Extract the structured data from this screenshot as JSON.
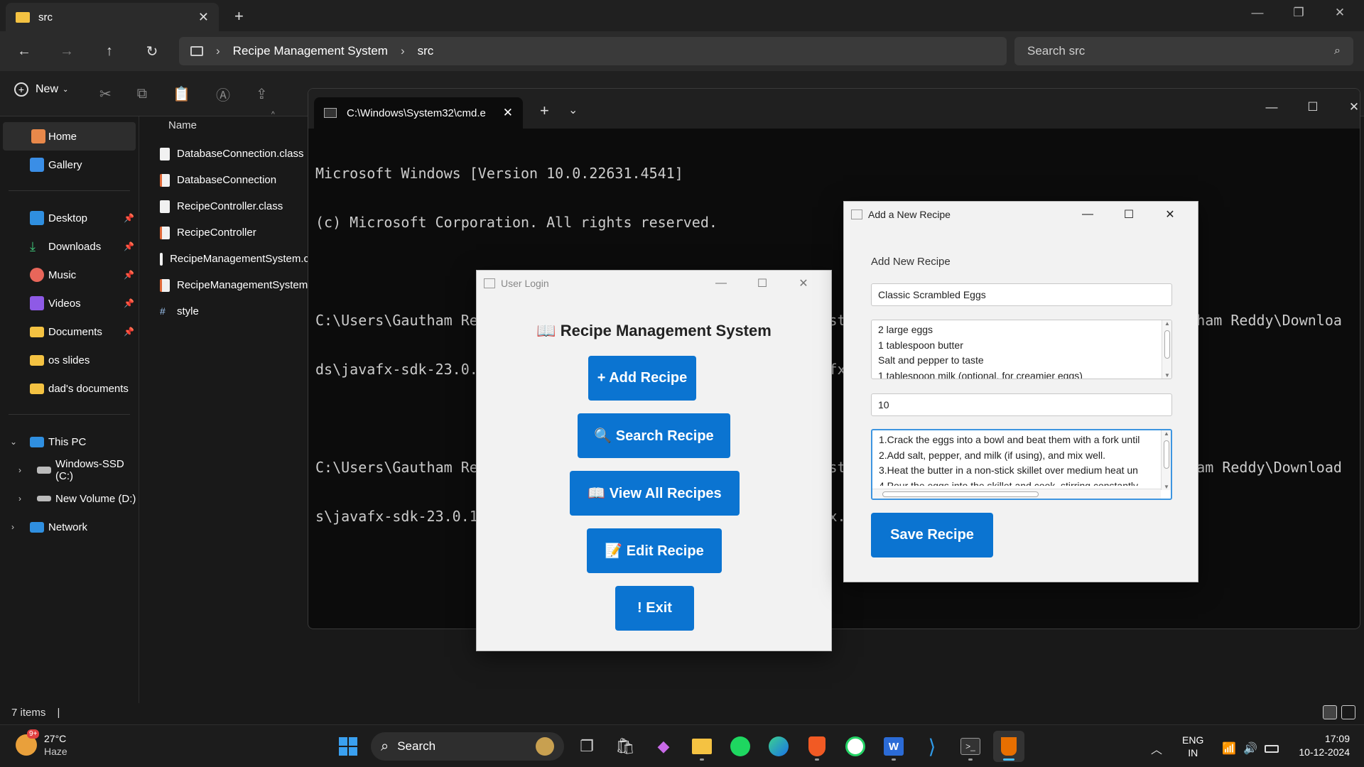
{
  "explorer": {
    "tab_title": "src",
    "breadcrumb": [
      "Recipe Management System",
      "src"
    ],
    "search_placeholder": "Search src",
    "new_label": "New",
    "column_name": "Name",
    "nav": {
      "home": "Home",
      "gallery": "Gallery",
      "pinned": [
        "Desktop",
        "Downloads",
        "Music",
        "Videos",
        "Documents"
      ],
      "folders": [
        "os slides",
        "dad's documents"
      ],
      "this_pc": "This PC",
      "drives": [
        "Windows-SSD (C:)",
        "New Volume (D:)"
      ],
      "network": "Network"
    },
    "files": [
      {
        "name": "DatabaseConnection.class",
        "type": "class"
      },
      {
        "name": "DatabaseConnection",
        "type": "java"
      },
      {
        "name": "RecipeController.class",
        "type": "class"
      },
      {
        "name": "RecipeController",
        "type": "java"
      },
      {
        "name": "RecipeManagementSystem.c",
        "type": "class"
      },
      {
        "name": "RecipeManagementSystem",
        "type": "java"
      },
      {
        "name": "style",
        "type": "css"
      }
    ],
    "status": "7 items"
  },
  "cmd": {
    "tab_title": "C:\\Windows\\System32\\cmd.e",
    "lines": [
      "Microsoft Windows [Version 10.0.22631.4541]",
      "(c) Microsoft Corporation. All rights reserved.",
      "",
      "C:\\Users\\Gautham Reddy\\OneDrive\\Desktop\\Recipe Management System\\src>javac --module-path \"C:\\Users\\Gautham Reddy\\Downloa",
      "ds\\javafx-sdk-23.0.1\\lib\" --add-modules javafx.controls,javafx.fxml *.java",
      "",
      "C:\\Users\\Gautham Reddy\\OneDrive\\Desktop\\Recipe Management System\\src>java --module-path \"C:\\Users\\Gautham Reddy\\Download",
      "s\\javafx-sdk-23.0.1\\lib\" --add-modules javafx.controls,javafx.fxml RecipeManagementSystem"
    ]
  },
  "login": {
    "title": "User Login",
    "heading": "📖 Recipe Management System",
    "buttons": {
      "add": "+ Add Recipe",
      "search": "🔍 Search Recipe",
      "view": "📖 View All Recipes",
      "edit": "📝 Edit Recipe",
      "exit": "! Exit"
    }
  },
  "add_recipe": {
    "title": "Add a New Recipe",
    "label": "Add New Recipe",
    "name_value": "Classic Scrambled Eggs",
    "ingredients": [
      "2 large eggs",
      "1 tablespoon butter",
      "Salt and pepper to taste",
      "1 tablespoon milk (optional, for creamier eggs)"
    ],
    "time_value": "10",
    "instructions": [
      "1.Crack the eggs into a bowl and beat them with a fork until",
      "2.Add salt, pepper, and milk (if using), and mix well.",
      "3.Heat the butter in a non-stick skillet over medium heat un",
      "4.Pour the eggs into the skillet and cook, stirring constantly"
    ],
    "save_label": "Save Recipe"
  },
  "taskbar": {
    "weather_temp": "27°C",
    "weather_desc": "Haze",
    "weather_badge": "9+",
    "search_label": "Search",
    "lang_top": "ENG",
    "lang_bottom": "IN",
    "time": "17:09",
    "date": "10-12-2024"
  }
}
